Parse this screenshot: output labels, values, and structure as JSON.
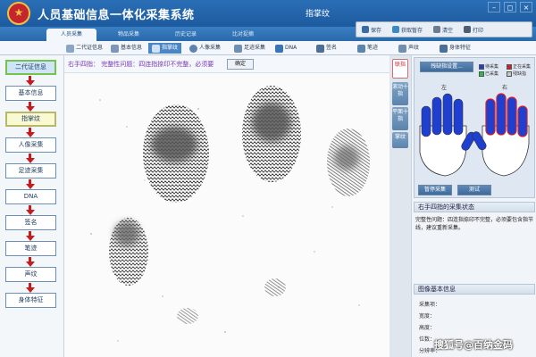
{
  "app": {
    "title": "人员基础信息一体化采集系统",
    "window_title": "指掌纹",
    "controls": [
      "–",
      "◻",
      "×"
    ]
  },
  "main_tabs": [
    {
      "label": "人员采集",
      "active": true
    },
    {
      "label": "物品采集",
      "active": false
    },
    {
      "label": "历史记录",
      "active": false
    },
    {
      "label": "比对捉摘",
      "active": false
    }
  ],
  "actions": [
    {
      "label": "保存",
      "icon": "save-icon",
      "color": "#3b6aa8"
    },
    {
      "label": "获取暂存",
      "icon": "fetch-icon",
      "color": "#3b8ac8"
    },
    {
      "label": "清空",
      "icon": "clear-icon",
      "color": "#6a7d91"
    },
    {
      "label": "打印",
      "icon": "print-icon",
      "color": "#4c5f74"
    }
  ],
  "sub_tabs": [
    {
      "label": "二代证信息",
      "icon": "id-card-icon",
      "active": false
    },
    {
      "label": "基本信息",
      "icon": "basic-info-icon",
      "active": false
    },
    {
      "label": "指掌纹",
      "icon": "fingerprint-icon",
      "active": true
    },
    {
      "label": "人像采集",
      "icon": "portrait-icon",
      "active": false
    },
    {
      "label": "足迹采集",
      "icon": "footprint-icon",
      "active": false
    },
    {
      "label": "DNA",
      "icon": "dna-icon",
      "active": false
    },
    {
      "label": "签名",
      "icon": "signature-icon",
      "active": false
    },
    {
      "label": "笔迹",
      "icon": "handwriting-icon",
      "active": false
    },
    {
      "label": "声纹",
      "icon": "voiceprint-icon",
      "active": false
    },
    {
      "label": "身体特征",
      "icon": "body-feature-icon",
      "active": false
    }
  ],
  "flow_steps": [
    {
      "label": "二代证信息",
      "state": "active"
    },
    {
      "label": "基本信息",
      "state": "normal"
    },
    {
      "label": "指掌纹",
      "state": "current"
    },
    {
      "label": "人像采集",
      "state": "normal"
    },
    {
      "label": "足迹采集",
      "state": "normal"
    },
    {
      "label": "DNA",
      "state": "normal"
    },
    {
      "label": "签名",
      "state": "normal"
    },
    {
      "label": "笔迹",
      "state": "normal"
    },
    {
      "label": "声纹",
      "state": "normal"
    },
    {
      "label": "身体特征",
      "state": "normal"
    }
  ],
  "capture": {
    "hint": "右手四指： 完整性问题：四连指捺印不完整，必须要",
    "confirm_label": "确定"
  },
  "side_tabs": [
    {
      "label": "联指",
      "active": true
    },
    {
      "label": "滚动十指",
      "active": false
    },
    {
      "label": "平面十指",
      "active": false
    },
    {
      "label": "掌纹",
      "active": false
    }
  ],
  "right_panel": {
    "unavailable_btn": "残缺指设置...",
    "legend": [
      {
        "label": "待采集",
        "color": "#1f3fd0"
      },
      {
        "label": "正在采集",
        "color": "#d01f2b"
      },
      {
        "label": "已采集",
        "color": "#22c23a"
      },
      {
        "label": "残缺指",
        "color": "#c8c8c8"
      }
    ],
    "left_label": "左",
    "right_label": "右",
    "pause_btn": "暂停采集",
    "test_btn": "测试",
    "status_header": "右手四指的采集状态",
    "status_text": "完整性问题：四连指捺印不完整，必须要包含指节线，建议重新采集。",
    "image_info_header": "图像基本信息",
    "image_info": [
      "采集项：",
      "宽度：",
      "高度：",
      "位数：",
      "分辨率："
    ]
  },
  "watermark": "搜狐号@百纳金码"
}
